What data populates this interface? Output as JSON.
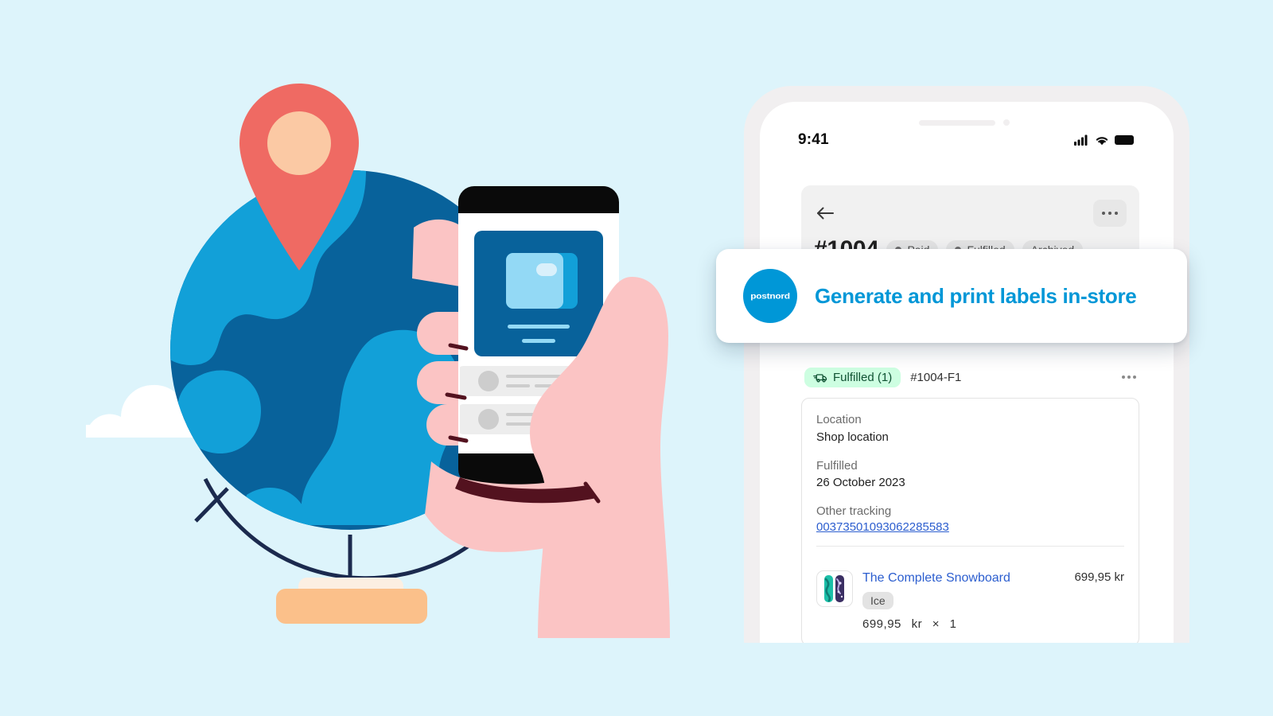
{
  "colors": {
    "background": "#ddf4fb",
    "brand_blue": "#0097d7",
    "globe_dark": "#08629b",
    "globe_light": "#12a0d8",
    "pin_red": "#ef6a63",
    "pin_inner": "#fbc9a4",
    "skin": "#fbc4c4",
    "stand_orange": "#fbc08a",
    "link_blue": "#2c5ecf",
    "green_badge_bg": "#cdfee1",
    "green_badge_text": "#0f5132"
  },
  "illustration": {
    "name": "globe-with-location-pin-and-hand-holding-phone",
    "globe_label": "globe",
    "pin_label": "map-location-pin",
    "clouds_label": "clouds",
    "phone_label": "hand-holding-phone",
    "stand_label": "globe-stand"
  },
  "phone": {
    "status_bar": {
      "time": "9:41",
      "cellular_icon": "cellular-signal-icon",
      "wifi_icon": "wifi-icon",
      "battery_icon": "battery-full-icon"
    },
    "order_header": {
      "back_icon": "back-arrow-icon",
      "more_icon": "more-options-icon",
      "order_number": "#1004",
      "badges": [
        {
          "label": "Paid",
          "has_dot": true
        },
        {
          "label": "Fulfilled",
          "has_dot": true
        },
        {
          "label": "Archived",
          "has_dot": false
        }
      ]
    },
    "fulfillment": {
      "status_badge": "Fulfilled (1)",
      "status_icon": "delivery-truck-icon",
      "fulfillment_id": "#1004-F1",
      "more_icon": "more-options-icon",
      "fields": [
        {
          "label": "Location",
          "value": "Shop location"
        },
        {
          "label": "Fulfilled",
          "value": "26 October 2023"
        }
      ],
      "tracking_label": "Other tracking",
      "tracking_number": "00373501093062285583",
      "line_item": {
        "thumbnail_alt": "snowboard-product-thumbnail",
        "title": "The Complete Snowboard",
        "price": "699,95 kr",
        "variant": "Ice",
        "unit_price": "699,95",
        "currency": "kr",
        "times": "×",
        "quantity": "1"
      }
    }
  },
  "toast": {
    "logo_text": "postnord",
    "logo_name": "postnord-logo",
    "message": "Generate and print labels in-store"
  }
}
